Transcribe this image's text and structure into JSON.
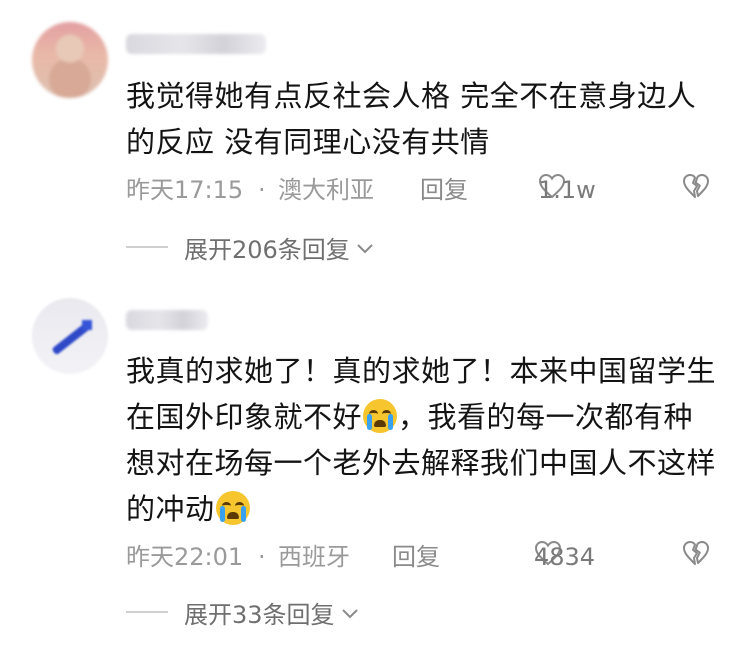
{
  "comments": [
    {
      "content": "我觉得她有点反社会人格 完全不在意身边人的反应 没有同理心没有共情",
      "time": "昨天17:15",
      "separator": "·",
      "location": "澳大利亚",
      "reply_label": "回复",
      "like_count": "1.1w",
      "expand_label": "展开206条回复"
    },
    {
      "content_parts": [
        "我真的求她了！真的求她了！本来中国留学生在国外印象就不好",
        "，我看的每一次都有种想对在场每一个老外去解释我们中国人不这样的冲动"
      ],
      "emoji": "loudly-crying-face",
      "time": "昨天22:01",
      "separator": "·",
      "location": "西班牙",
      "reply_label": "回复",
      "like_count": "4834",
      "expand_label": "展开33条回复"
    }
  ],
  "colors": {
    "text": "#141414",
    "meta": "#9a9a9a",
    "background": "#ffffff"
  }
}
